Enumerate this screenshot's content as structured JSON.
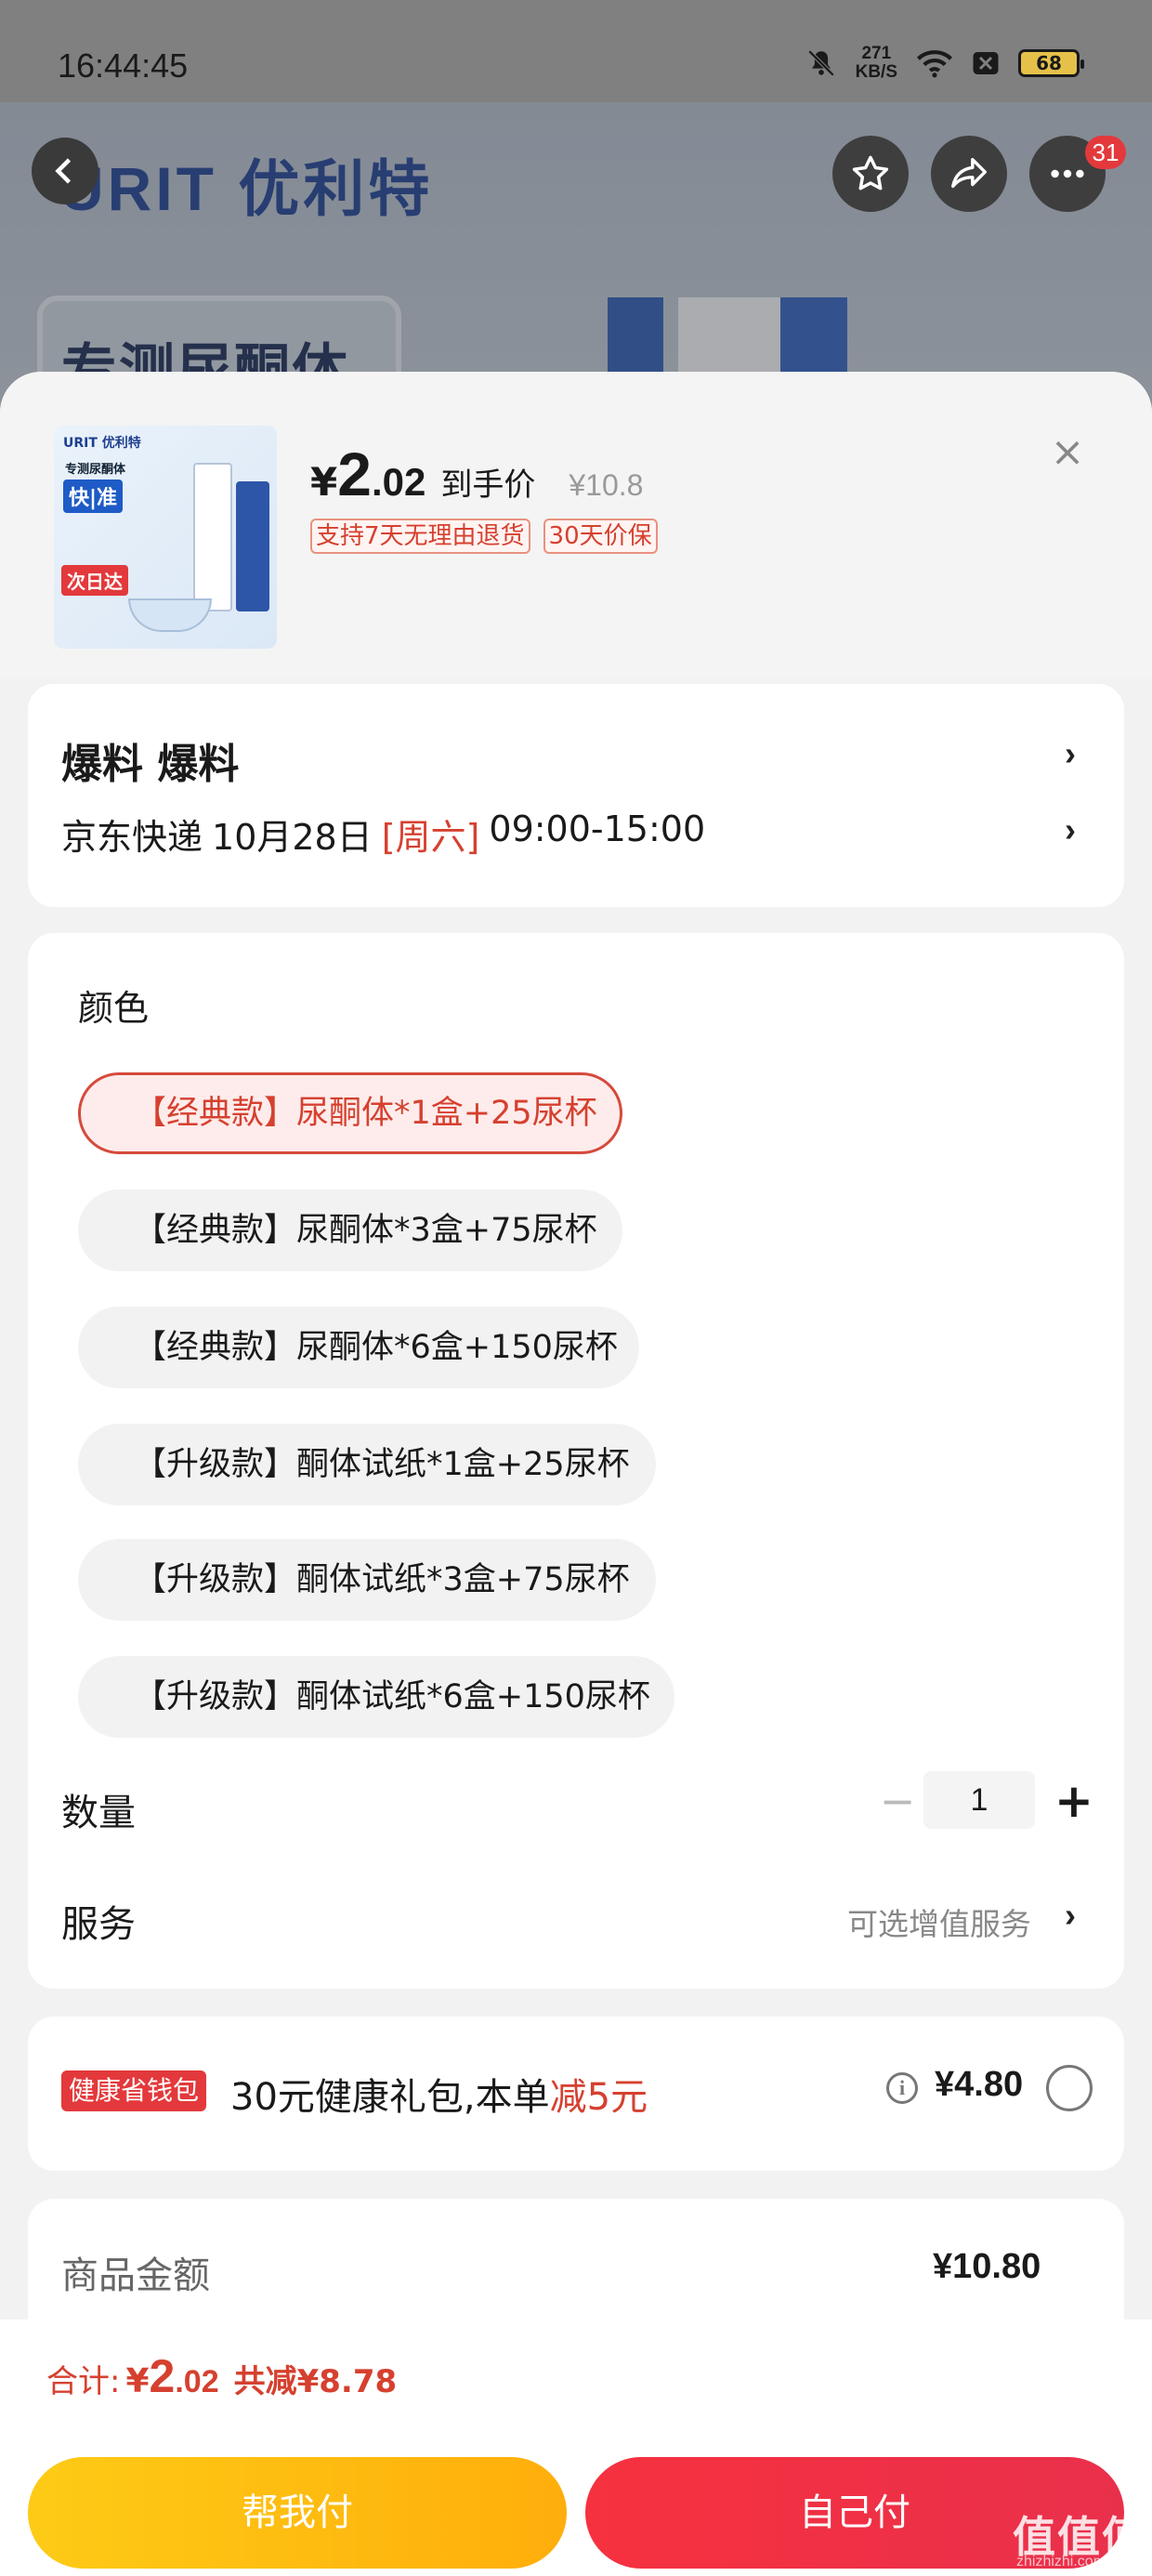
{
  "status_bar": {
    "time": "16:44:45",
    "net_speed": "271",
    "net_unit": "KB/S",
    "battery": "68"
  },
  "background": {
    "brand": "URIT 优利特",
    "banner_text": "专测尿酮体"
  },
  "nav": {
    "more_badge": "31"
  },
  "product": {
    "image_labels": {
      "brand": "URIT 优利特",
      "line": "专测尿酮体",
      "big": "快|准",
      "tag": "次日达"
    },
    "price_yen": "¥",
    "price_int": "2",
    "price_dec": ".02",
    "price_label": "到手价",
    "original_price": "¥10.8",
    "tags": [
      "支持7天无理由退货",
      "30天价保"
    ],
    "close_icon": "×"
  },
  "address": {
    "name": "爆料  爆料",
    "carrier": "京东快递",
    "date": "10月28日",
    "weekday": "[周六]",
    "time_window": "09:00-15:00"
  },
  "spec": {
    "label": "颜色",
    "options": [
      "【经典款】尿酮体*1盒+25尿杯",
      "【经典款】尿酮体*3盒+75尿杯",
      "【经典款】尿酮体*6盒+150尿杯",
      "【升级款】酮体试纸*1盒+25尿杯",
      "【升级款】酮体试纸*3盒+75尿杯",
      "【升级款】酮体试纸*6盒+150尿杯"
    ],
    "selected_index": 0,
    "quantity_label": "数量",
    "quantity_minus": "−",
    "quantity": "1",
    "quantity_plus": "+",
    "service_label": "服务",
    "service_hint": "可选增值服务"
  },
  "promo": {
    "tag": "健康省钱包",
    "text": "30元健康礼包,本单",
    "highlight": "减5元",
    "price": "¥4.80"
  },
  "totals": {
    "goods_label": "商品金额",
    "goods_value": "¥10.80"
  },
  "footer": {
    "sum_label": "合计:",
    "sum_yen": "¥",
    "sum_int": "2",
    "sum_dec": ".02",
    "saved": "共减¥8.78",
    "friend_pay": "帮我付",
    "self_pay": "自己付"
  },
  "watermark": {
    "main": "值值值",
    "sub": "zhizhizhi.com"
  },
  "colors": {
    "accent_red": "#d6402f",
    "badge_red": "#e3393c",
    "friend_button": "#ffb80e",
    "self_button": "#ee3044"
  }
}
